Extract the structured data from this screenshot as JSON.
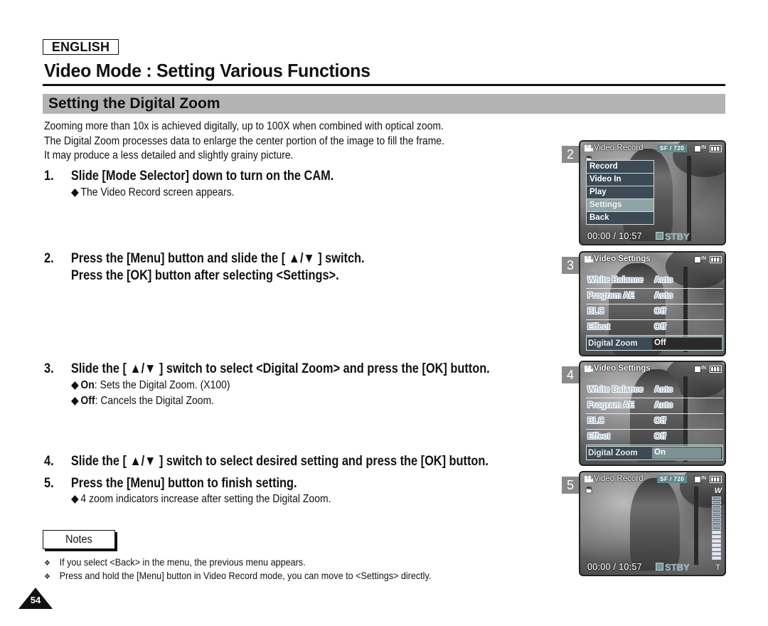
{
  "language_badge": "ENGLISH",
  "page_title": "Video Mode : Setting Various Functions",
  "section_title": "Setting the Digital Zoom",
  "intro_lines": [
    "Zooming more than 10x is achieved digitally, up to 100X when combined with optical zoom.",
    "The Digital Zoom processes data to enlarge the center portion of the image to fill the frame.",
    "It may produce a less detailed and slightly grainy picture."
  ],
  "steps": [
    {
      "num": "1.",
      "text": "Slide [Mode Selector] down to turn on the CAM.",
      "sub": [
        "The Video Record screen appears."
      ]
    },
    {
      "num": "2.",
      "text": "Press the [Menu] button and slide the [ ▲/▼ ] switch.",
      "text2": "Press the [OK] button after selecting <Settings>."
    },
    {
      "num": "3.",
      "text": "Slide the [ ▲/▼ ] switch to select <Digital Zoom> and press the [OK] button.",
      "sub_items": [
        {
          "bold": "On",
          "rest": ": Sets the Digital Zoom. (X100)"
        },
        {
          "bold": "Off",
          "rest": ": Cancels the Digital Zoom."
        }
      ]
    },
    {
      "num": "4.",
      "text": "Slide the [ ▲/▼ ] switch to select desired setting and press the [OK] button."
    },
    {
      "num": "5.",
      "text": "Press the [Menu] button to finish setting.",
      "sub": [
        "4 zoom indicators increase after setting the Digital Zoom."
      ]
    }
  ],
  "bullet_glyph": "◆",
  "notes": {
    "label": "Notes",
    "bullet_glyph": "❖",
    "items": [
      "If you select <Back> in the menu, the previous menu appears.",
      "Press and hold the [Menu] button in Video Record mode, you can move to <Settings> directly."
    ]
  },
  "page_number": "54",
  "screens": {
    "s2": {
      "num": "2",
      "title": "Video Record",
      "badge": "SF  /  720",
      "card_label": "IN",
      "menu": [
        "Record",
        "Video In",
        "Play",
        "Settings",
        "Back"
      ],
      "selected_index": 3,
      "time": "00:00 / 10:57",
      "status": "STBY"
    },
    "s3": {
      "num": "3",
      "title": "Video Settings",
      "card_label": "IN",
      "rows": [
        {
          "label": "White Balance",
          "value": "Auto"
        },
        {
          "label": "Program AE",
          "value": "Auto"
        },
        {
          "label": "BLC",
          "value": "Off"
        },
        {
          "label": "Effect",
          "value": "Off"
        }
      ],
      "selected": {
        "label": "Digital Zoom",
        "value": "Off"
      }
    },
    "s4": {
      "num": "4",
      "title": "Video Settings",
      "card_label": "IN",
      "rows": [
        {
          "label": "White Balance",
          "value": "Auto"
        },
        {
          "label": "Program AE",
          "value": "Auto"
        },
        {
          "label": "BLC",
          "value": "Off"
        },
        {
          "label": "Effect",
          "value": "Off"
        }
      ],
      "selected": {
        "label": "Digital Zoom",
        "value": "On"
      }
    },
    "s5": {
      "num": "5",
      "title": "Video Record",
      "badge": "SF  /  720",
      "card_label": "IN",
      "time": "00:00 / 10:57",
      "status": "STBY",
      "zoom_wide_label": "W",
      "zoom_tele_label": "T",
      "zoom_segments_total": 15,
      "zoom_segments_lit": 8
    }
  },
  "colors": {
    "section_bar": "#b3b3b3",
    "menu_bg": "#3b4a55",
    "menu_selected": "#8fa4a6",
    "accent_teal": "#6f9a9c"
  }
}
